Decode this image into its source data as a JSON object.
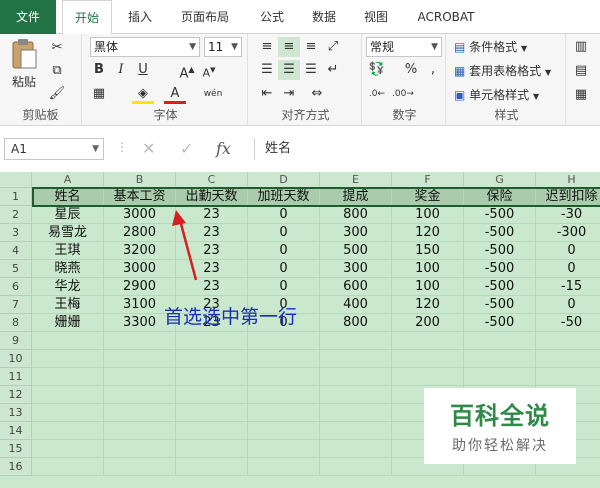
{
  "tabs": [
    "文件",
    "开始",
    "插入",
    "页面布局",
    "公式",
    "数据",
    "视图",
    "ACROBAT"
  ],
  "ribbon": {
    "clipboard": {
      "label": "剪贴板",
      "paste": "粘贴"
    },
    "font": {
      "label": "字体",
      "name": "黑体",
      "size": "11",
      "wen": "wén"
    },
    "alignment": {
      "label": "对齐方式"
    },
    "number": {
      "label": "数字",
      "format": "常规"
    },
    "styles": {
      "label": "样式",
      "cond_format": "条件格式",
      "table_format": "套用表格格式",
      "cell_styles": "单元格样式"
    }
  },
  "formula_bar": {
    "name_box": "A1",
    "fx": "fx",
    "content": "姓名"
  },
  "columns": [
    "A",
    "B",
    "C",
    "D",
    "E",
    "F",
    "G",
    "H"
  ],
  "rows": [
    "1",
    "2",
    "3",
    "4",
    "5",
    "6",
    "7",
    "8",
    "9",
    "10",
    "11",
    "12",
    "13",
    "14",
    "15",
    "16"
  ],
  "table": {
    "headers": [
      "姓名",
      "基本工资",
      "出勤天数",
      "加班天数",
      "提成",
      "奖金",
      "保险",
      "迟到扣除"
    ],
    "data": [
      [
        "星辰",
        "3000",
        "23",
        "0",
        "800",
        "100",
        "-500",
        "-30"
      ],
      [
        "易雪龙",
        "2800",
        "23",
        "0",
        "300",
        "120",
        "-500",
        "-300"
      ],
      [
        "王琪",
        "3200",
        "23",
        "0",
        "500",
        "150",
        "-500",
        "0"
      ],
      [
        "晓燕",
        "3000",
        "23",
        "0",
        "300",
        "100",
        "-500",
        "0"
      ],
      [
        "华龙",
        "2900",
        "23",
        "0",
        "600",
        "100",
        "-500",
        "-15"
      ],
      [
        "王梅",
        "3100",
        "23",
        "0",
        "400",
        "120",
        "-500",
        "0"
      ],
      [
        "姗姗",
        "3300",
        "23",
        "0",
        "800",
        "200",
        "-500",
        "-50"
      ]
    ]
  },
  "annotation": "首选选中第一行",
  "watermark": {
    "title": "百科全说",
    "subtitle": "助你轻松解决"
  },
  "colors": {
    "excel_green": "#217346",
    "grid_bg": "#c9e8cd",
    "annotation": "#1a2db5",
    "arrow": "#d42020"
  }
}
